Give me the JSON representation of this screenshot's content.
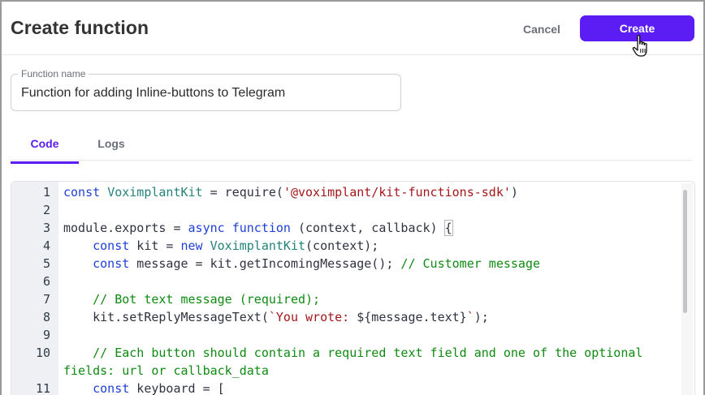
{
  "header": {
    "title": "Create function",
    "cancel_label": "Cancel",
    "create_label": "Create"
  },
  "form": {
    "function_name_label": "Function name",
    "function_name_value": "Function for adding Inline-buttons to Telegram"
  },
  "tabs": [
    {
      "label": "Code",
      "active": true
    },
    {
      "label": "Logs",
      "active": false
    }
  ],
  "editor": {
    "line_numbers": [
      "1",
      "2",
      "3",
      "4",
      "5",
      "6",
      "7",
      "8",
      "9",
      "10",
      "11"
    ],
    "lines": [
      "const VoximplantKit = require('@voximplant/kit-functions-sdk')",
      "",
      "module.exports = async function (context, callback) {",
      "    const kit = new VoximplantKit(context);",
      "    const message = kit.getIncomingMessage(); // Customer message",
      "",
      "    // Bot text message (required);",
      "    kit.setReplyMessageText(`You wrote: ${message.text}`);",
      "",
      "    // Each button should contain a required text field and one of the optional fields: url or callback_data",
      "    const keyboard = ["
    ]
  },
  "colors": {
    "accent": "#5c1df5",
    "keyword": "#1f3fd6",
    "class_name": "#24837a",
    "string": "#a3171a",
    "comment": "#0f8a12"
  },
  "icons": {
    "cursor": "hand-pointer-icon"
  }
}
